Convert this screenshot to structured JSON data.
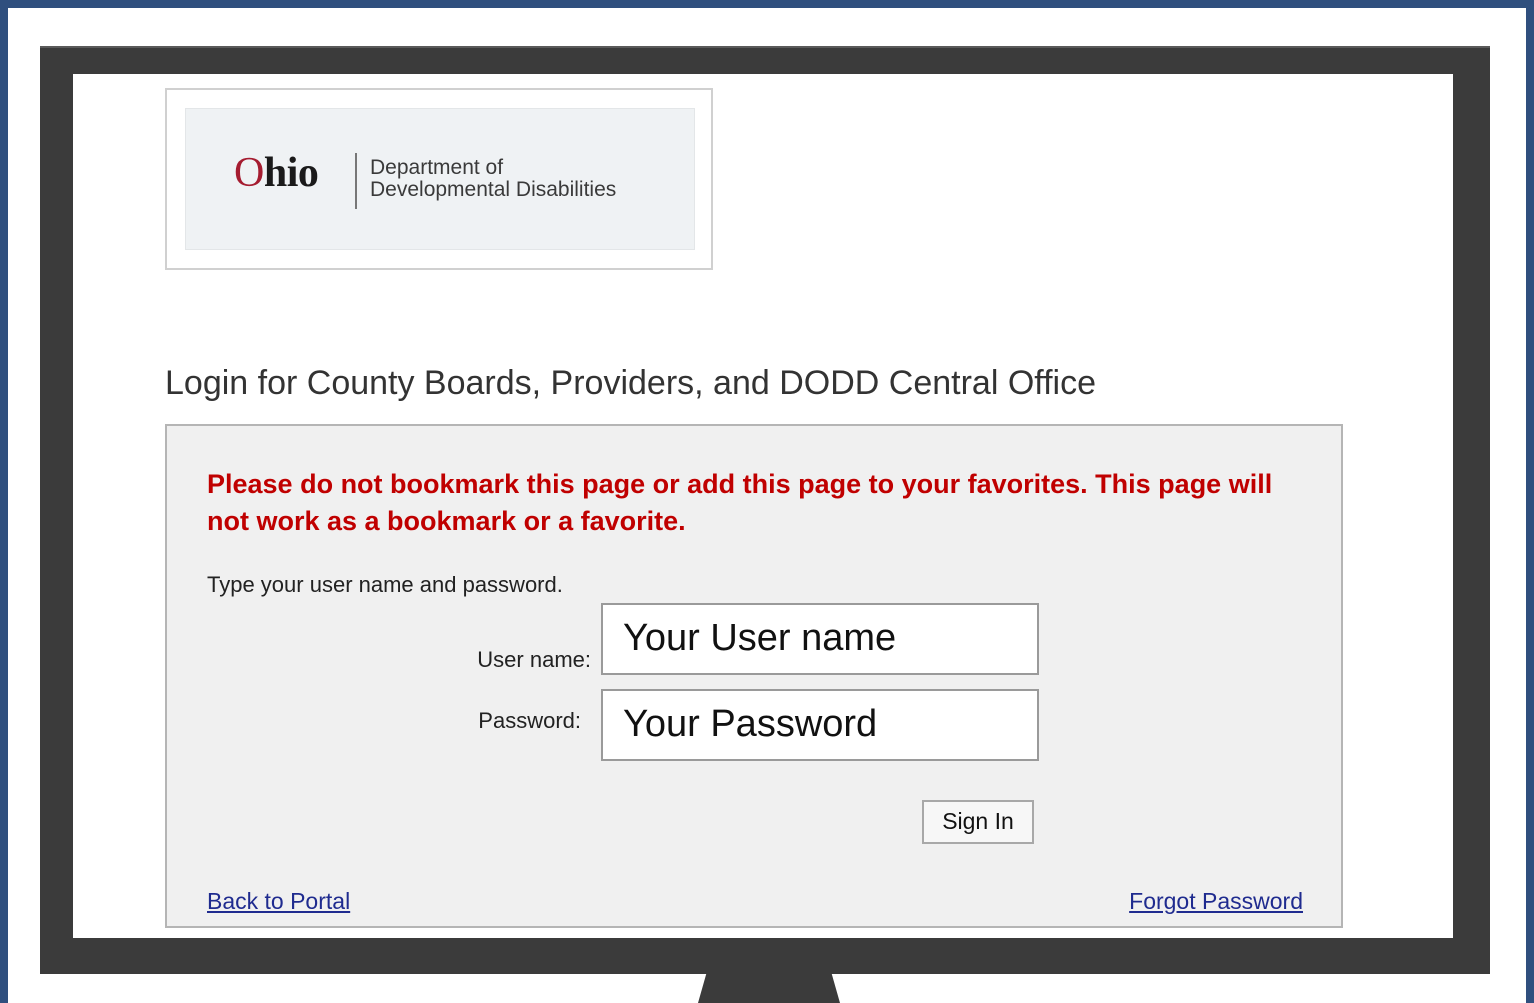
{
  "logo": {
    "ohio_o": "O",
    "ohio_rest": "hio",
    "dept_line1": "Department of",
    "dept_line2": "Developmental Disabilities"
  },
  "heading": "Login for County Boards, Providers, and DODD Central Office",
  "login": {
    "warning": "Please do not bookmark this page or add this page to your favorites. This page will not work as a bookmark or a favorite.",
    "instruction": "Type your user name and password.",
    "username_label": "User name:",
    "username_value": "Your User name",
    "password_label": "Password:",
    "password_value": "Your Password",
    "signin_label": "Sign In",
    "back_link": "Back to Portal",
    "forgot_link": "Forgot Password"
  },
  "colors": {
    "frame_border": "#2f4f7e",
    "monitor": "#3b3b3b",
    "warning": "#c00000",
    "link": "#1f2b8f",
    "ohio_accent": "#a51c30"
  }
}
